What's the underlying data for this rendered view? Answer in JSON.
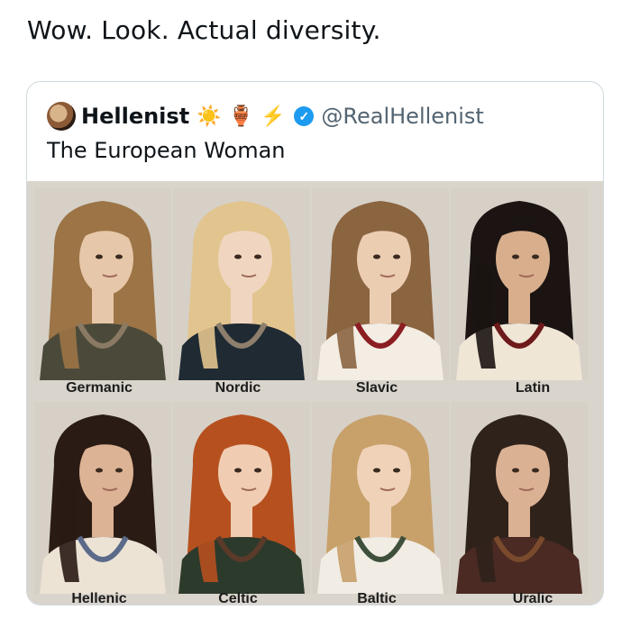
{
  "post": {
    "text": "Wow. Look. Actual diversity."
  },
  "quote": {
    "display_name": "Hellenist",
    "emojis": [
      "☀️",
      "🏺",
      "⚡"
    ],
    "handle": "@RealHellenist",
    "text": "The European Woman"
  },
  "portraits": [
    {
      "label": "Germanic",
      "hair": "#9c7446",
      "skin": "#e7c7a9",
      "cloth": "#4b4a3a",
      "accent": "#8a7a64"
    },
    {
      "label": "Nordic",
      "hair": "#e2c48e",
      "skin": "#f0d6c0",
      "cloth": "#1f2a33",
      "accent": "#8d7f6c"
    },
    {
      "label": "Slavic",
      "hair": "#8b6440",
      "skin": "#ebcdb2",
      "cloth": "#f3ede4",
      "accent": "#8b1e22"
    },
    {
      "label": "Latin",
      "hair": "#1b1412",
      "skin": "#d8ae8c",
      "cloth": "#efe6d6",
      "accent": "#6e1a1a"
    },
    {
      "label": "Hellenic",
      "hair": "#2a1b14",
      "skin": "#dcb394",
      "cloth": "#ece3d5",
      "accent": "#5c6a8a"
    },
    {
      "label": "Celtic",
      "hair": "#b6501f",
      "skin": "#f0cdb2",
      "cloth": "#2c3a2c",
      "accent": "#5b3a2a"
    },
    {
      "label": "Baltic",
      "hair": "#c8a06a",
      "skin": "#efd2b8",
      "cloth": "#f1ece4",
      "accent": "#3e4f3a"
    },
    {
      "label": "Uralic",
      "hair": "#2f221b",
      "skin": "#dbb193",
      "cloth": "#4a2a22",
      "accent": "#7a4a2c"
    }
  ]
}
